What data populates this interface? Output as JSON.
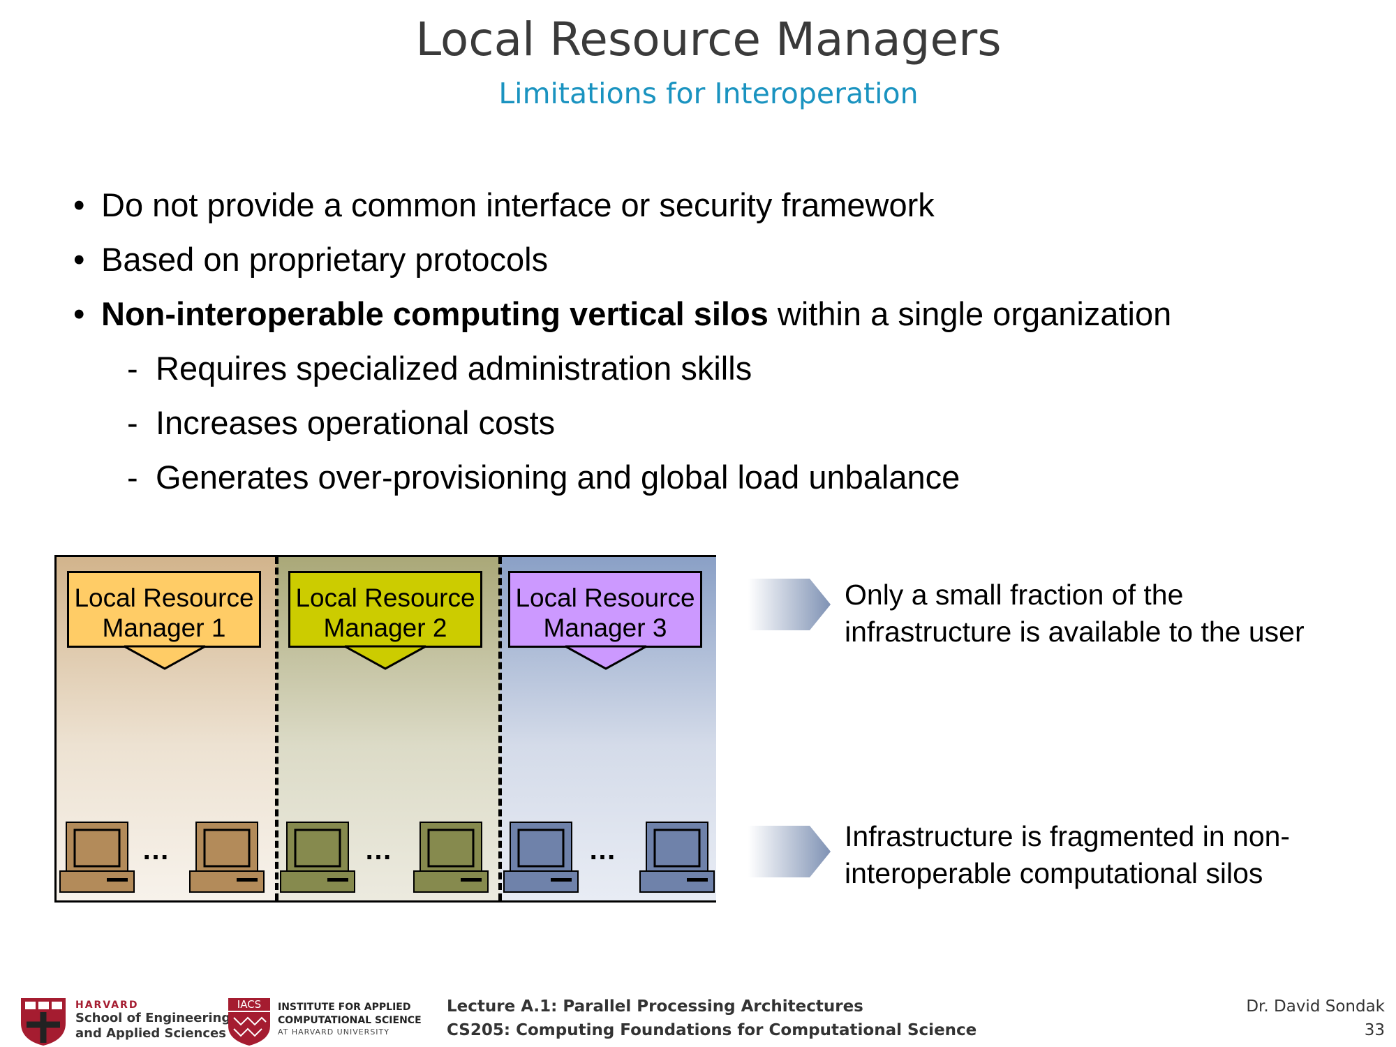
{
  "slide": {
    "title": "Local Resource Managers",
    "subtitle": "Limitations for Interoperation"
  },
  "bullets": [
    {
      "marker": "•",
      "text": "Do not provide a common interface or security framework"
    },
    {
      "marker": "•",
      "text": "Based on proprietary protocols"
    },
    {
      "marker": "•",
      "bold": "Non-interoperable computing vertical silos",
      "text": " within a single organization"
    }
  ],
  "subbullets": [
    {
      "marker": "-",
      "text": "Requires specialized administration skills"
    },
    {
      "marker": "-",
      "text": "Increases operational costs"
    },
    {
      "marker": "-",
      "text": "Generates over-provisioning and global load unbalance"
    }
  ],
  "diagram": {
    "managers": [
      {
        "line1": "Local Resource",
        "line2": "Manager 1",
        "color": "#ffcc66",
        "pc_color": "#b38b5a"
      },
      {
        "line1": "Local Resource",
        "line2": "Manager 2",
        "color": "#cccc00",
        "pc_color": "#868a4e"
      },
      {
        "line1": "Local Resource",
        "line2": "Manager 3",
        "color": "#cc99ff",
        "pc_color": "#6f82aa"
      }
    ],
    "ellipsis": "…"
  },
  "callouts": [
    {
      "line1": "Only a small fraction of the",
      "line2": "infrastructure is available to the user"
    },
    {
      "line1": "Infrastructure is fragmented in non-",
      "line2": "interoperable computational silos"
    }
  ],
  "footer": {
    "harvard_label": "HARVARD",
    "harvard_line1": "School of Engineering",
    "harvard_line2": "and Applied Sciences",
    "iacs_badge": "IACS",
    "iacs_line1": "INSTITUTE FOR APPLIED",
    "iacs_line2": "COMPUTATIONAL SCIENCE",
    "iacs_line3": "AT HARVARD UNIVERSITY",
    "lecture": "Lecture A.1: Parallel Processing Architectures",
    "course": "CS205: Computing Foundations for Computational Science",
    "author": "Dr. David Sondak",
    "page": "33"
  }
}
